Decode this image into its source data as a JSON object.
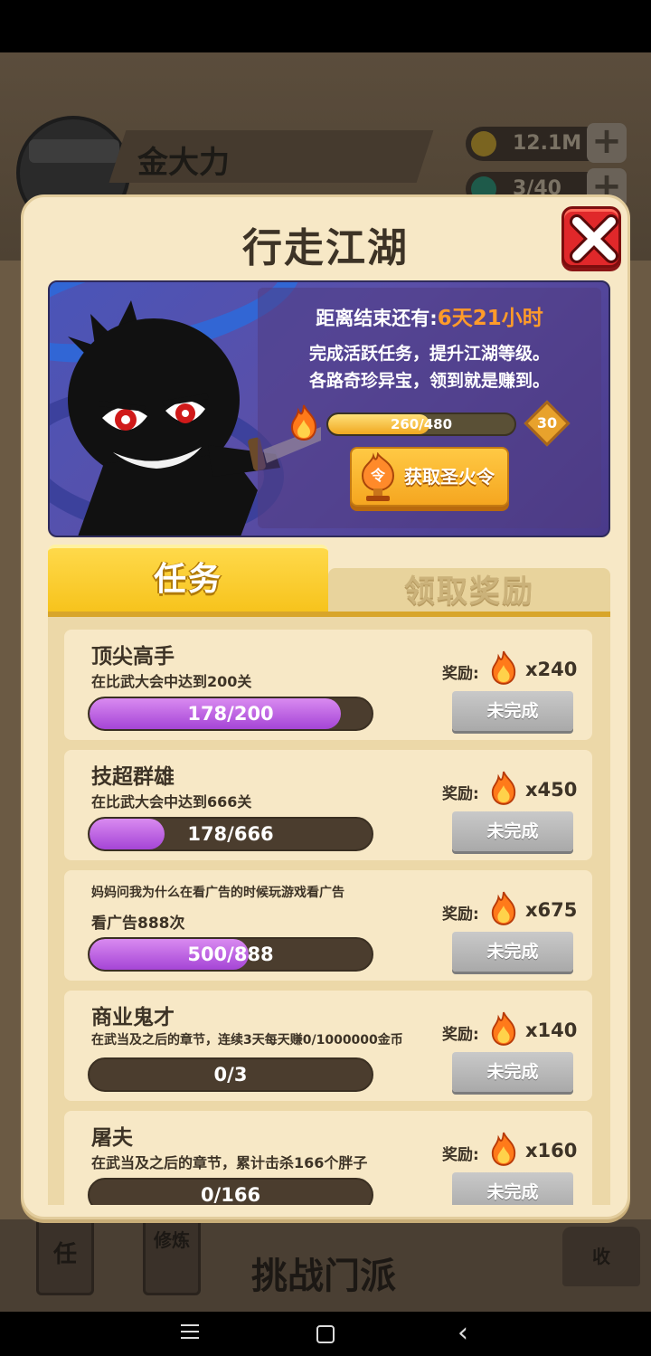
{
  "background": {
    "player_name": "金大力",
    "gold": "12.1M",
    "gems": "3/40",
    "bottom_tabs": [
      "任",
      "修炼",
      "收"
    ],
    "challenge_label": "挑战门派"
  },
  "modal": {
    "title": "行走江湖",
    "banner": {
      "countdown_label": "距离结束还有:",
      "countdown_value": "6天21小时",
      "desc_line1": "完成活跃任务，提升江湖等级。",
      "desc_line2": "各路奇珍异宝，领到就是赚到。",
      "xp_text": "260/480",
      "xp_fraction": 0.5417,
      "level": "30",
      "get_button_label": "获取圣火令",
      "token_icon_text": "令"
    },
    "tabs": {
      "active": "任务",
      "inactive": "领取奖励"
    },
    "reward_label": "奖励:",
    "tasks": [
      {
        "name": "顶尖高手",
        "desc": "在比武大会中达到200关",
        "progress_text": "178/200",
        "progress": 0.89,
        "reward": "x240",
        "status": "未完成"
      },
      {
        "name": "技超群雄",
        "desc": "在比武大会中达到666关",
        "progress_text": "178/666",
        "progress": 0.267,
        "reward": "x450",
        "status": "未完成"
      },
      {
        "name": "妈妈问我为什么在看广告的时候玩游戏看广告",
        "desc": "看广告888次",
        "progress_text": "500/888",
        "progress": 0.563,
        "reward": "x675",
        "status": "未完成"
      },
      {
        "name": "商业鬼才",
        "desc": "在武当及之后的章节，连续3天每天赚0/1000000金币",
        "progress_text": "0/3",
        "progress": 0,
        "reward": "x140",
        "status": "未完成"
      },
      {
        "name": "屠夫",
        "desc": "在武当及之后的章节，累计击杀166个胖子",
        "progress_text": "0/166",
        "progress": 0,
        "reward": "x160",
        "status": "未完成"
      }
    ]
  },
  "colors": {
    "modal_bg": "#f7e8c6",
    "accent_orange": "#ff9b2a",
    "progress_purple": "#a545d6",
    "tab_yellow": "#f6c21a",
    "close_red": "#e0282a"
  }
}
